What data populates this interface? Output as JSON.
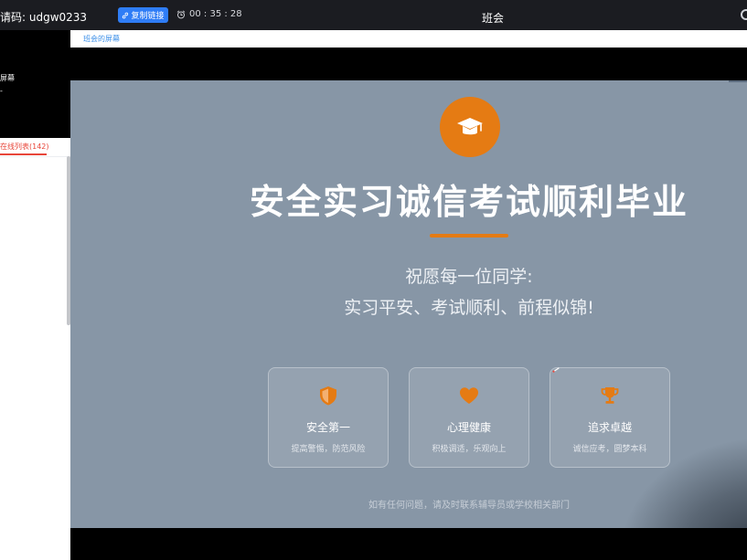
{
  "topbar": {
    "invite_text": "请码: udgw0233",
    "copy_link_label": "复制链接",
    "timer": "00 : 35 : 28",
    "title": "班会"
  },
  "sidebar": {
    "screen_label": "屏幕",
    "dash": "-",
    "online_tab": "在线列表(142)"
  },
  "screen_tab": {
    "label": "班会的屏幕"
  },
  "slide": {
    "headline": "安全实习诚信考试顺利毕业",
    "wish_line1": "祝愿每一位同学:",
    "wish_line2": "实习平安、考试顺利、前程似锦!",
    "cards": [
      {
        "icon": "shield-icon",
        "title": "安全第一",
        "subtitle": "提高警惕，防范风险"
      },
      {
        "icon": "heart-icon",
        "title": "心理健康",
        "subtitle": "积极调适，乐观向上"
      },
      {
        "icon": "trophy-icon",
        "title": "追求卓越",
        "subtitle": "诚信应考，圆梦本科"
      }
    ],
    "footnote": "如有任何问题，请及时联系辅导员或学校相关部门"
  },
  "colors": {
    "accent_orange": "#e57b13",
    "slide_bg": "#8796a6",
    "link_blue": "#3c8fe8",
    "online_red": "#e8463a",
    "copy_button_blue": "#2f7df6"
  }
}
